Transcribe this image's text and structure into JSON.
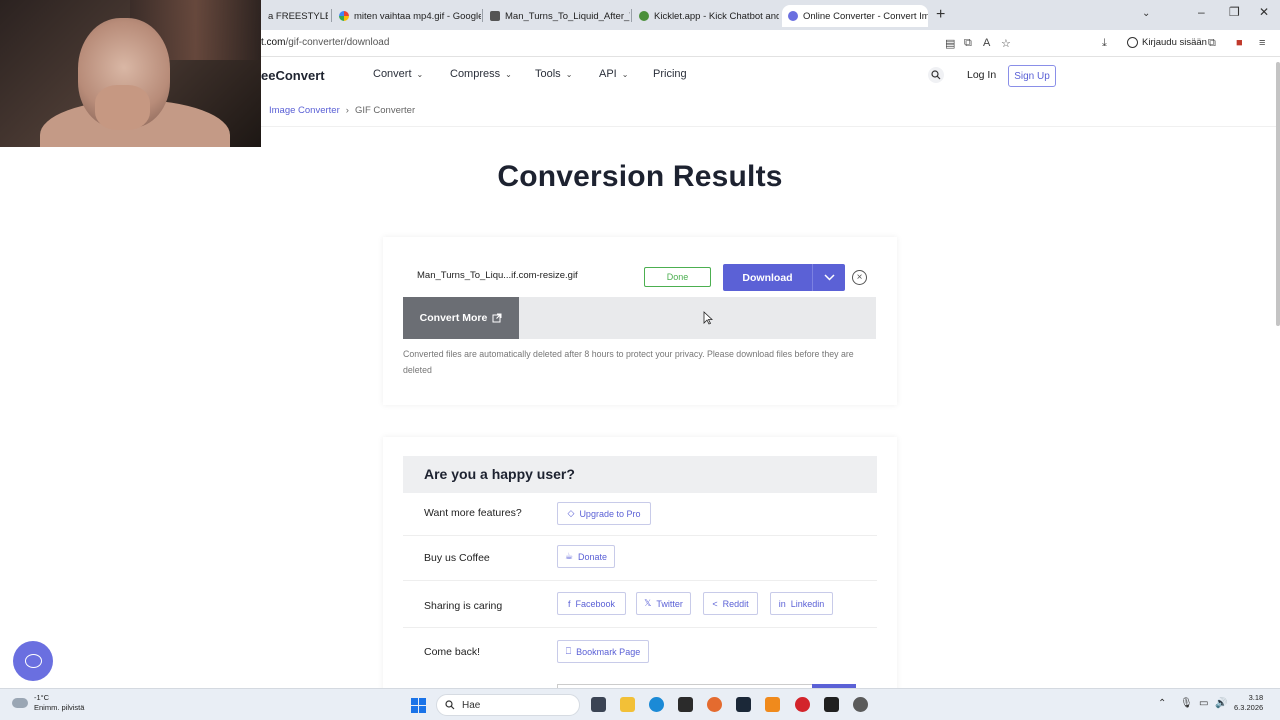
{
  "browser": {
    "tabs": [
      {
        "label": "a FREESTYLE -",
        "active": false
      },
      {
        "label": "miten vaihtaa mp4.gif - Google",
        "active": false
      },
      {
        "label": "Man_Turns_To_Liquid_After_Trip",
        "active": false
      },
      {
        "label": "Kicklet.app - Kick Chatbot and C",
        "active": false
      },
      {
        "label": "Online Converter - Convert Ima",
        "active": true
      }
    ],
    "url_host": "t.com",
    "url_path": "/gif-converter/download",
    "signin_label": "Kirjaudu sisään"
  },
  "site": {
    "logo": "eeConvert",
    "nav": [
      "Convert",
      "Compress",
      "Tools",
      "API",
      "Pricing"
    ],
    "login": "Log In",
    "signup": "Sign Up",
    "breadcrumb": [
      "Image Converter",
      "GIF Converter"
    ]
  },
  "main": {
    "title": "Conversion Results",
    "file": {
      "name": "Man_Turns_To_Liqu...if.com-resize.gif",
      "status": "Done",
      "download_label": "Download"
    },
    "convert_more": "Convert More",
    "notice": "Converted files are automatically deleted after 8 hours to protect your privacy. Please download files before they are deleted"
  },
  "happy": {
    "title": "Are you a happy user?",
    "rows": [
      {
        "label": "Want more features?",
        "buttons": [
          "Upgrade to Pro"
        ]
      },
      {
        "label": "Buy us Coffee",
        "buttons": [
          "Donate"
        ]
      },
      {
        "label": "Sharing is caring",
        "buttons": [
          "Facebook",
          "Twitter",
          "Reddit",
          "Linkedin"
        ]
      },
      {
        "label": "Come back!",
        "buttons": [
          "Bookmark Page"
        ]
      }
    ]
  },
  "taskbar": {
    "weather_temp": "-1°C",
    "weather_text": "Enimm. pilvistä",
    "search": "Hae",
    "time": "3.18",
    "date": "6.3.2026"
  },
  "colors": {
    "accent": "#5b61d6",
    "done": "#4caf50",
    "convert_more_bg": "#6b6e74"
  }
}
